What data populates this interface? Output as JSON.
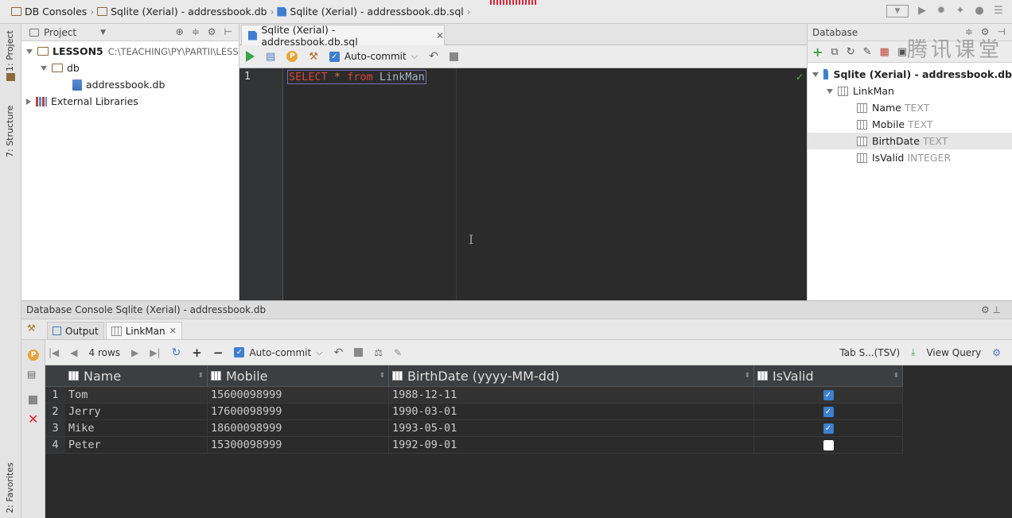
{
  "breadcrumb": [
    {
      "label": "DB Consoles",
      "icon": "folder-icon"
    },
    {
      "label": "Sqlite (Xerial) - addressbook.db",
      "icon": "folder-icon"
    },
    {
      "label": "Sqlite (Xerial) - addressbook.db.sql",
      "icon": "sql-file-icon"
    }
  ],
  "left_strip": {
    "project": "1: Project",
    "structure": "7: Structure",
    "favorites": "2: Favorites"
  },
  "project_panel": {
    "title": "Project",
    "tree": [
      {
        "label": "LESSON5",
        "path": "C:\\TEACHING\\PY\\PARTII\\LESS"
      },
      {
        "label": "db"
      },
      {
        "label": "addressbook.db"
      },
      {
        "label": "External Libraries"
      }
    ]
  },
  "editor": {
    "tab_label": "Sqlite (Xerial) - addressbook.db.sql",
    "auto_commit": "Auto-commit",
    "line_number": "1",
    "code": {
      "select": "SELECT",
      "star": "*",
      "from": "from",
      "table": "LinkMan"
    }
  },
  "database_panel": {
    "title": "Database",
    "watermark": "腾讯课堂",
    "datasource": "Sqlite (Xerial) - addressbook.db",
    "table": "LinkMan",
    "columns": [
      {
        "name": "Name",
        "type": "TEXT"
      },
      {
        "name": "Mobile",
        "type": "TEXT"
      },
      {
        "name": "BirthDate",
        "type": "TEXT"
      },
      {
        "name": "IsValid",
        "type": "INTEGER"
      }
    ]
  },
  "console": {
    "title": "Database Console Sqlite (Xerial) - addressbook.db",
    "tabs": [
      "Output",
      "LinkMan"
    ],
    "rows_label": "4 rows",
    "auto_commit": "Auto-commit",
    "export_format": "Tab S...(TSV)",
    "view_query": "View Query",
    "headers": [
      "Name",
      "Mobile",
      "BirthDate (yyyy-MM-dd)",
      "IsValid"
    ],
    "rows": [
      {
        "n": "1",
        "name": "Tom",
        "mobile": "15600098999",
        "birth": "1988-12-11",
        "valid": true
      },
      {
        "n": "2",
        "name": "Jerry",
        "mobile": "17600098999",
        "birth": "1990-03-01",
        "valid": true
      },
      {
        "n": "3",
        "name": "Mike",
        "mobile": "18600098999",
        "birth": "1993-05-01",
        "valid": true
      },
      {
        "n": "4",
        "name": "Peter",
        "mobile": "15300098999",
        "birth": "1992-09-01",
        "valid": false
      }
    ]
  }
}
